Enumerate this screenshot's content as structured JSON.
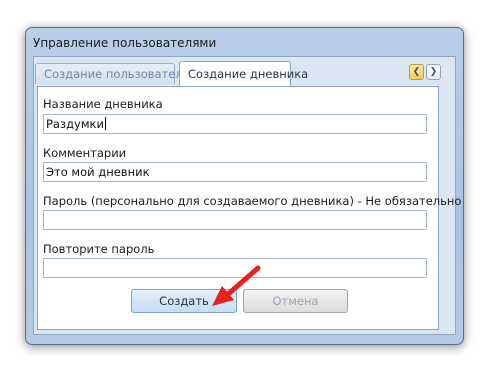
{
  "window": {
    "title": "Управление пользователями"
  },
  "tabs": [
    {
      "label": "Создание пользователя",
      "active": false
    },
    {
      "label": "Создание дневника",
      "active": true
    }
  ],
  "tab_nav": {
    "prev_icon": "chevron-left-icon",
    "next_icon": "chevron-right-icon"
  },
  "form": {
    "diary_name": {
      "label": "Название дневника",
      "value": "Раздумки"
    },
    "comment": {
      "label": "Комментарии",
      "value": "Это мой дневник"
    },
    "password": {
      "label": "Пароль (персонально для создаваемого дневника) - Не обязательно",
      "value": ""
    },
    "password_repeat": {
      "label": "Повторите пароль",
      "value": ""
    }
  },
  "buttons": {
    "create": "Создать",
    "cancel": "Отмена"
  },
  "annotation": {
    "arrow_color": "#e8201c"
  }
}
